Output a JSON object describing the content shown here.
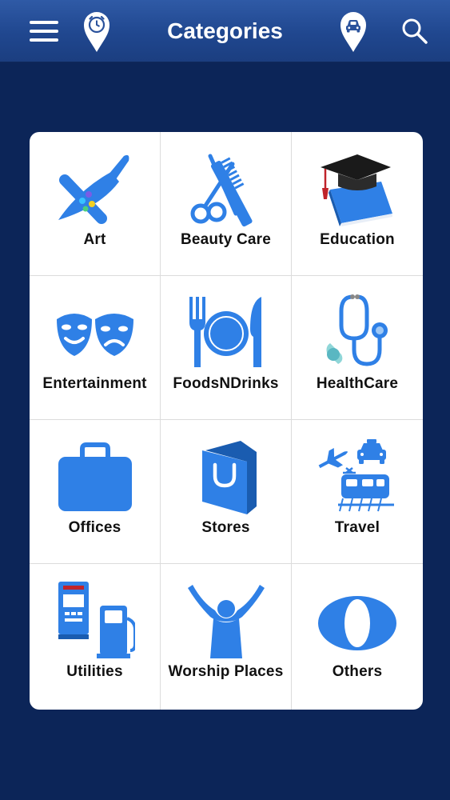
{
  "header": {
    "title": "Categories",
    "menu_icon": "hamburger-menu-icon",
    "alarm_pin_icon": "alarm-location-pin-icon",
    "car_pin_icon": "car-location-pin-icon",
    "search_icon": "search-icon"
  },
  "colors": {
    "background": "#0c2558",
    "header": "#2a529c",
    "icon_blue": "#2f80e6",
    "card": "#ffffff"
  },
  "categories": [
    {
      "label": "Art",
      "icon": "paintbrush-palette-icon"
    },
    {
      "label": "Beauty Care",
      "icon": "scissors-comb-icon"
    },
    {
      "label": "Education",
      "icon": "graduation-cap-book-icon"
    },
    {
      "label": "Entertainment",
      "icon": "theater-masks-icon"
    },
    {
      "label": "FoodsNDrinks",
      "icon": "fork-plate-knife-icon"
    },
    {
      "label": "HealthCare",
      "icon": "stethoscope-icon"
    },
    {
      "label": "Offices",
      "icon": "briefcase-icon"
    },
    {
      "label": "Stores",
      "icon": "shopping-bag-icon"
    },
    {
      "label": "Travel",
      "icon": "plane-taxi-train-icon"
    },
    {
      "label": "Utilities",
      "icon": "atm-fuel-pump-icon"
    },
    {
      "label": "Worship Places",
      "icon": "raised-arms-person-icon"
    },
    {
      "label": "Others",
      "icon": "letter-o-icon"
    }
  ]
}
